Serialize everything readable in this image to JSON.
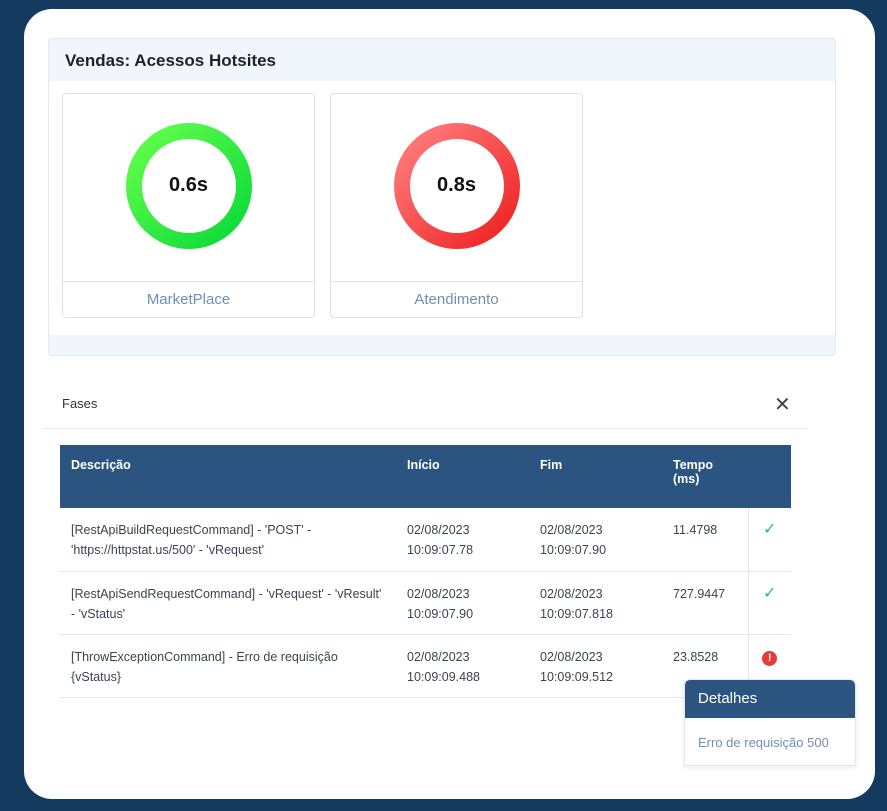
{
  "panel": {
    "title": "Vendas: Acessos Hotsites",
    "gauges": [
      {
        "label": "MarketPlace",
        "value": "0.6s",
        "status": "ok",
        "color": "#22e03a"
      },
      {
        "label": "Atendimento",
        "value": "0.8s",
        "status": "slow",
        "color": "#ff5a5a"
      }
    ]
  },
  "modal": {
    "title": "Fases",
    "close_icon": "close-icon",
    "columns": [
      "Descrição",
      "Início",
      "Fim",
      "Tempo (ms)"
    ],
    "rows": [
      {
        "descricao": "[RestApiBuildRequestCommand] - 'POST' - 'https://httpstat.us/500' - 'vRequest'",
        "inicio": "02/08/2023 10:09:07.78",
        "fim": "02/08/2023 10:09:07.90",
        "tempo": "11.4798",
        "status": "success",
        "status_icon": "check-icon"
      },
      {
        "descricao": "[RestApiSendRequestCommand] - 'vRequest' - 'vResult' - 'vStatus'",
        "inicio": "02/08/2023 10:09:07.90",
        "fim": "02/08/2023 10:09:07.818",
        "tempo": "727.9447",
        "status": "success",
        "status_icon": "check-icon"
      },
      {
        "descricao": "[ThrowExceptionCommand] - Erro de requisição {vStatus}",
        "inicio": "02/08/2023 10:09:09.488",
        "fim": "02/08/2023 10:09:09.512",
        "tempo": "23.8528",
        "status": "error",
        "status_icon": "error-icon"
      }
    ]
  },
  "details": {
    "title": "Detalhes",
    "message": "Erro de requisição 500"
  },
  "colors": {
    "background": "#143a60",
    "table_header": "#2c5480",
    "success": "#2bbf73",
    "error": "#e43b3b"
  }
}
